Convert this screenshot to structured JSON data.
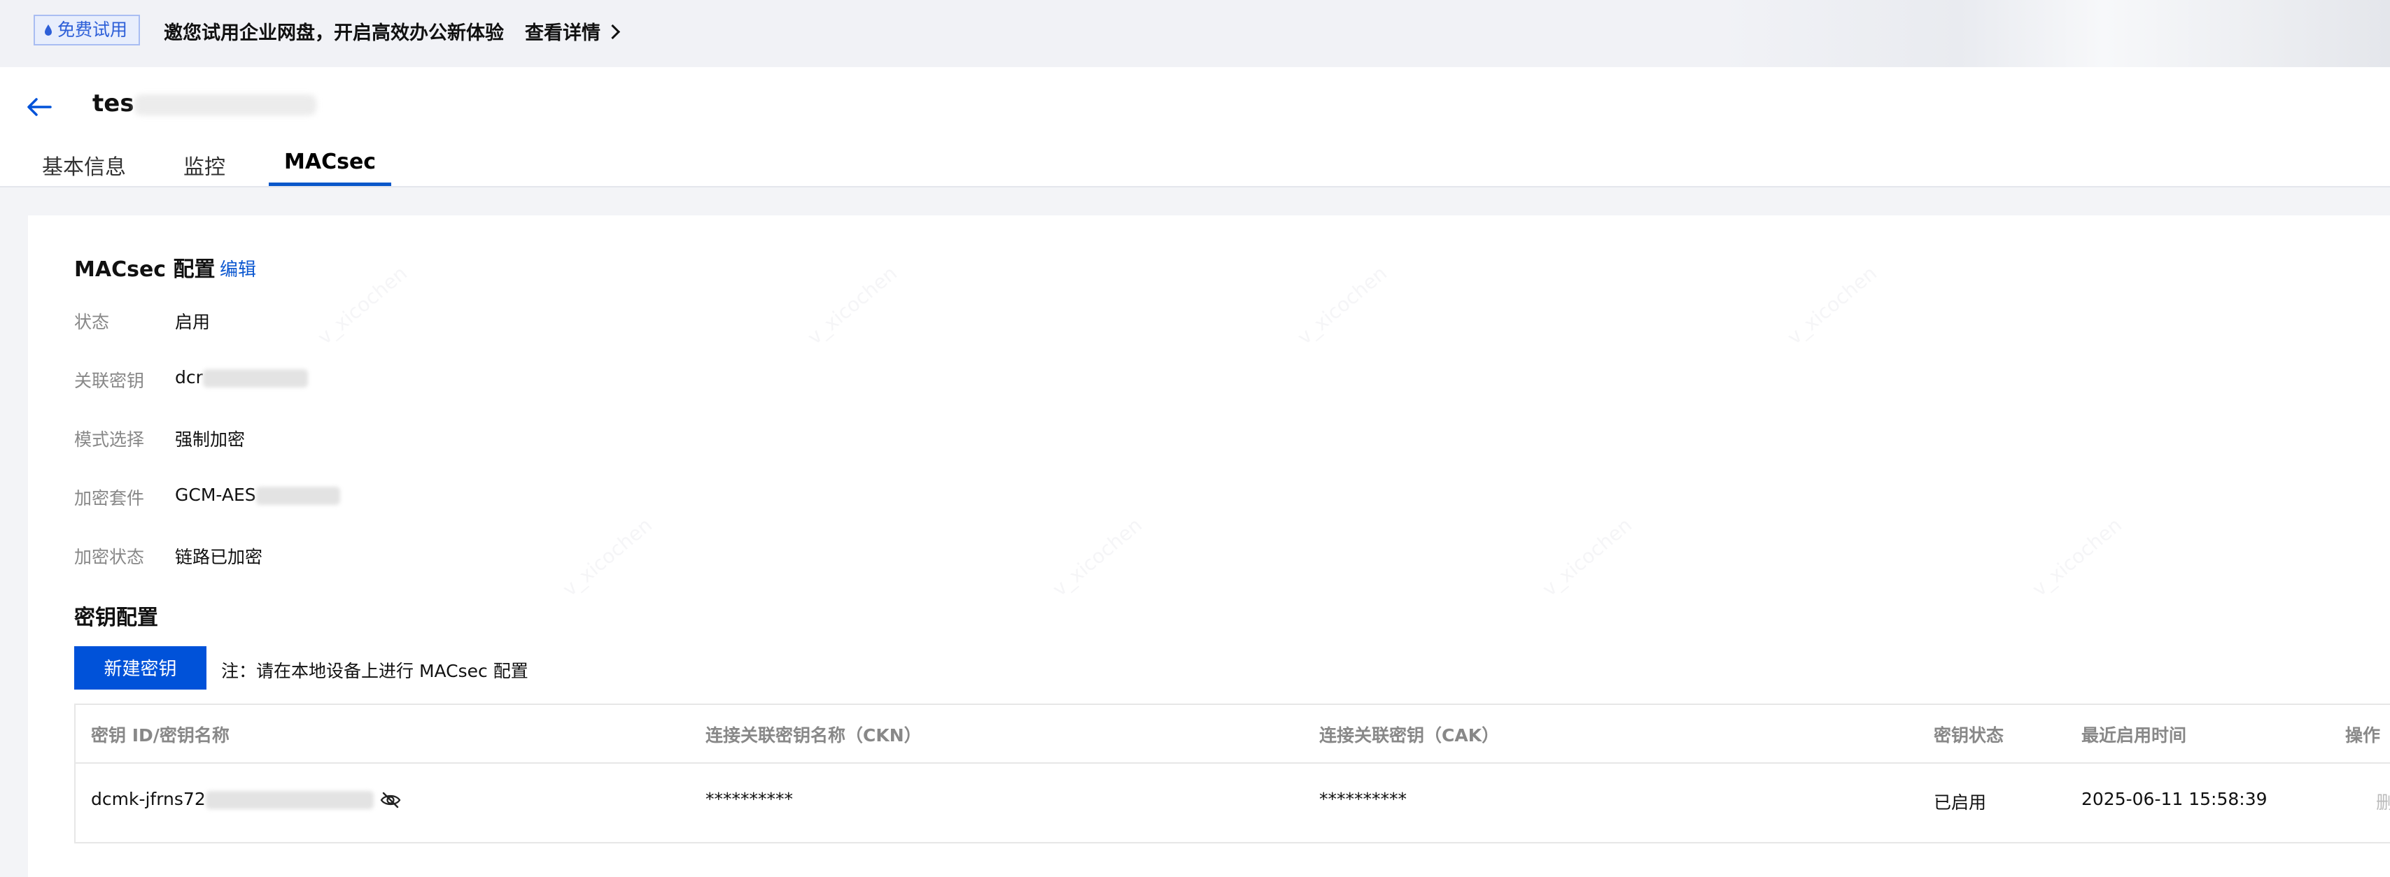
{
  "banner": {
    "badge": "免费试用",
    "message": "邀您试用企业网盘，开启高效办公新体验",
    "detail_link": "查看详情"
  },
  "header": {
    "title_visible": "tes",
    "tabs": [
      {
        "label": "基本信息",
        "active": false
      },
      {
        "label": "监控",
        "active": false
      },
      {
        "label": "MACsec",
        "active": true
      }
    ]
  },
  "macsec_config": {
    "title": "MACsec 配置",
    "edit_label": "编辑",
    "fields": [
      {
        "label": "状态",
        "value": "启用"
      },
      {
        "label": "关联密钥",
        "value": "dcr"
      },
      {
        "label": "模式选择",
        "value": "强制加密"
      },
      {
        "label": "加密套件",
        "value": "GCM-AES"
      },
      {
        "label": "加密状态",
        "value": "链路已加密"
      }
    ]
  },
  "key_config": {
    "title": "密钥配置",
    "new_key_button": "新建密钥",
    "note": "注：请在本地设备上进行 MACsec 配置",
    "columns": [
      "密钥 ID/密钥名称",
      "连接关联密钥名称（CKN）",
      "连接关联密钥（CAK）",
      "密钥状态",
      "最近启用时间",
      "操作"
    ],
    "rows": [
      {
        "key_id": "dcmk-jfrns72",
        "ckn": "**********",
        "cak": "**********",
        "status": "已启用",
        "last_enabled": "2025-06-11 15:58:39",
        "action": "删除"
      }
    ]
  },
  "watermark_text": "v_xicochen",
  "colors": {
    "primary": "#0052d9",
    "link": "#0b57d0",
    "tab_underline": "#0a58ca",
    "badge_bg": "#e8eefc",
    "badge_border": "#a9bdf2",
    "badge_text": "#2d5fd8"
  }
}
